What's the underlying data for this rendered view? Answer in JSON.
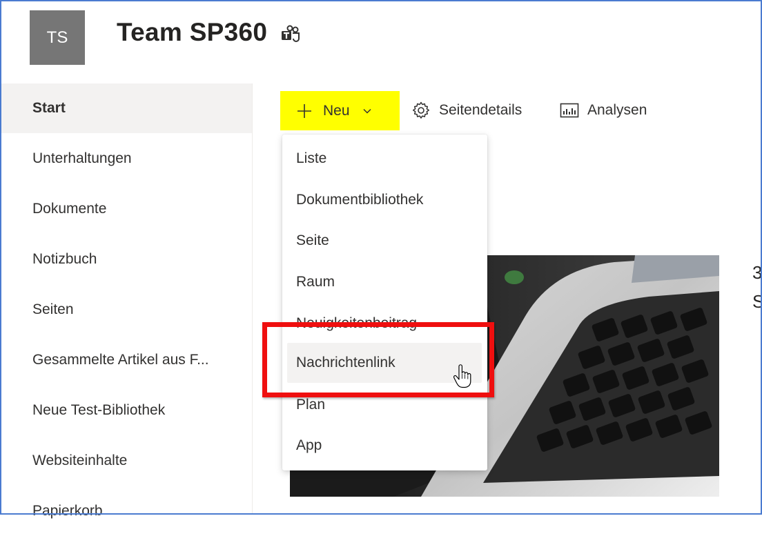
{
  "header": {
    "logo_initials": "TS",
    "site_title": "Team SP360",
    "teams_icon": "teams-icon"
  },
  "leftnav": {
    "items": [
      {
        "label": "Start",
        "active": true
      },
      {
        "label": "Unterhaltungen"
      },
      {
        "label": "Dokumente"
      },
      {
        "label": "Notizbuch"
      },
      {
        "label": "Seiten"
      },
      {
        "label": "Gesammelte Artikel aus F..."
      },
      {
        "label": "Neue Test-Bibliothek"
      },
      {
        "label": "Websiteinhalte"
      },
      {
        "label": "Papierkorb"
      }
    ]
  },
  "commandbar": {
    "new_label": "Neu",
    "details_label": "Seitendetails",
    "analytics_label": "Analysen",
    "highlight_color": "#ffff00"
  },
  "dropdown": {
    "items": [
      {
        "label": "Liste"
      },
      {
        "label": "Dokumentbibliothek"
      },
      {
        "label": "Seite"
      },
      {
        "label": "Raum"
      },
      {
        "label": "Neuigkeitenbeitrag"
      },
      {
        "label": "Nachrichtenlink",
        "hovered": true
      },
      {
        "label": "Plan"
      },
      {
        "label": "App"
      }
    ],
    "annotation_color": "#ef0f0f"
  },
  "content": {
    "right_text": [
      "3",
      "S"
    ]
  }
}
